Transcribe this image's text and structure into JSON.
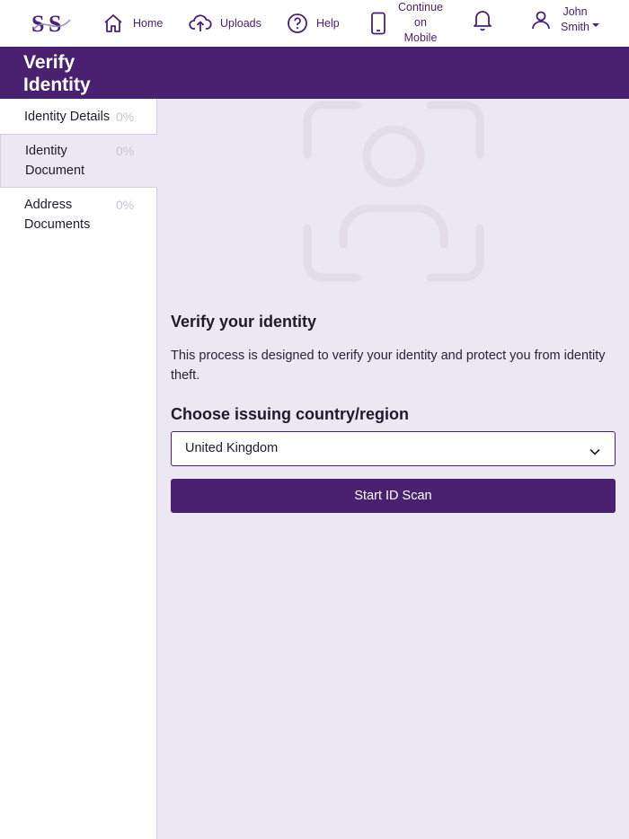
{
  "brand": {
    "logo_text": "SS",
    "logo_icon": "ss-logo"
  },
  "nav": {
    "home": {
      "label": "Home",
      "icon": "home-icon"
    },
    "uploads": {
      "label": "Uploads",
      "icon": "upload-cloud-icon"
    },
    "help": {
      "label": "Help",
      "icon": "help-circle-icon"
    },
    "mobile": {
      "line1": "Continue",
      "line2": "on",
      "line3": "Mobile",
      "icon": "mobile-phone-icon"
    },
    "notifications": {
      "icon": "bell-icon"
    },
    "user": {
      "first": "John",
      "last": "Smith",
      "icon": "user-icon",
      "menu_icon": "caret-down-icon"
    }
  },
  "banner": {
    "title": "Verify Identity"
  },
  "sidebar": {
    "items": [
      {
        "label": "Identity Details",
        "progress": "0%",
        "active": false
      },
      {
        "label": "Identity Document",
        "progress": "0%",
        "active": true
      },
      {
        "label": "Address Documents",
        "progress": "0%",
        "active": false
      }
    ]
  },
  "main": {
    "illustration_icon": "camera-frame-icon",
    "heading": "Verify your identity",
    "description": "This process is designed to verify your identity and protect you from identity theft.",
    "country_heading": "Choose issuing country/region",
    "country_select": {
      "value": "United Kingdom",
      "icon": "chevron-down-icon"
    },
    "start_button": "Start ID Scan"
  },
  "colors": {
    "brand_purple": "#4a2070",
    "page_background": "#ebe7f3",
    "sidebar_muted": "#c8c2d6"
  }
}
